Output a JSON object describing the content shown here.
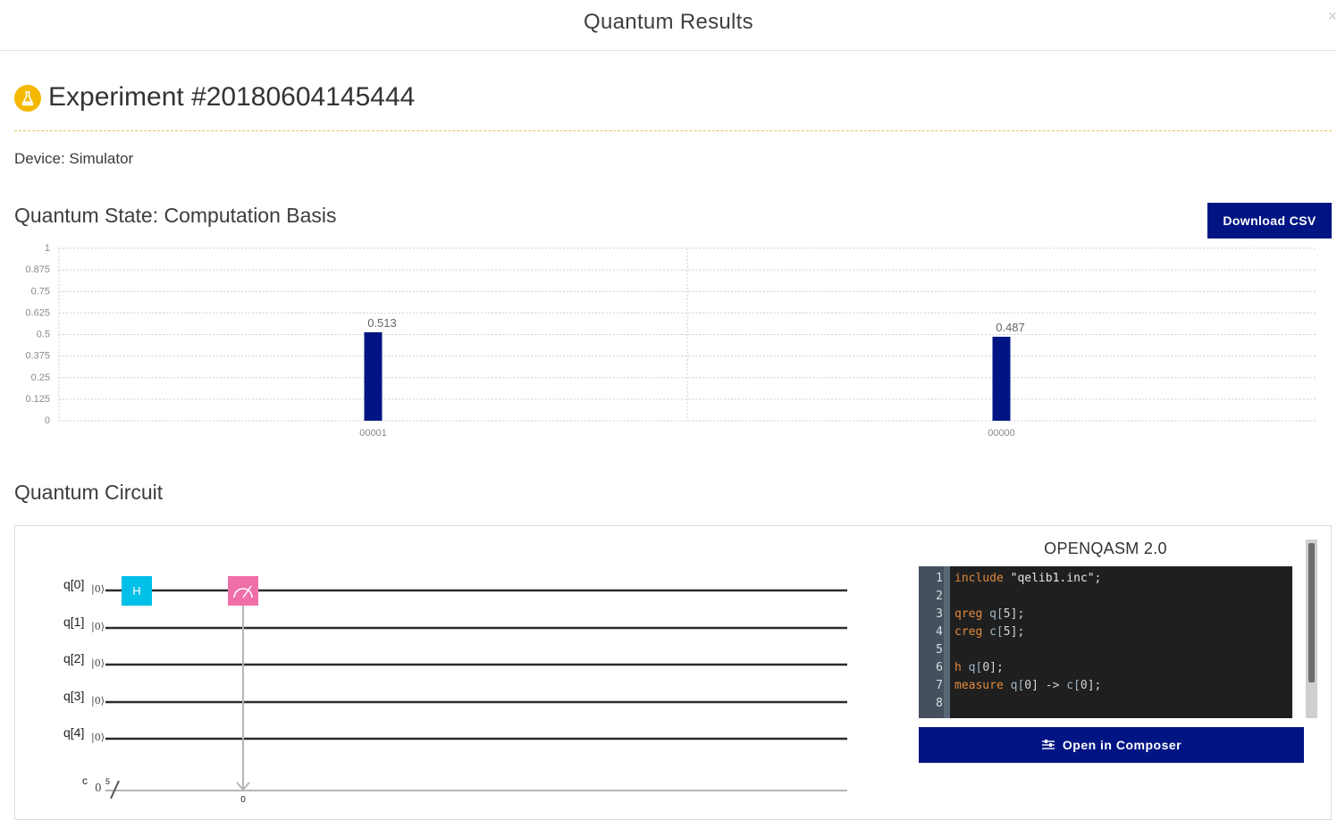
{
  "modal": {
    "title": "Quantum Results",
    "close": "×"
  },
  "experiment": {
    "title": "Experiment #20180604145444",
    "icon": "flask-icon"
  },
  "device": "Device: Simulator",
  "state_section": {
    "title": "Quantum State: Computation Basis",
    "download_label": "Download CSV"
  },
  "chart_data": {
    "type": "bar",
    "categories": [
      "00001",
      "00000"
    ],
    "values": [
      0.513,
      0.487
    ],
    "data_labels": [
      "0.513",
      "0.487"
    ],
    "yticks": [
      "1",
      "0.875",
      "0.75",
      "0.625",
      "0.5",
      "0.375",
      "0.25",
      "0.125",
      "0"
    ],
    "ylim": [
      0,
      1
    ],
    "grid": true,
    "bar_color": "#001583"
  },
  "circuit_section": {
    "title": "Quantum Circuit",
    "qubits": [
      "q[0]",
      "q[1]",
      "q[2]",
      "q[3]",
      "q[4]"
    ],
    "ket": "|0⟩",
    "classical": {
      "label": "c",
      "init": "0",
      "width": "5",
      "measure_target": "0"
    },
    "gates": [
      {
        "name": "H",
        "qubit": "q[0]",
        "color": "#00bfe8"
      },
      {
        "name": "measure",
        "qubit": "q[0]",
        "color": "#ef6fa8"
      }
    ]
  },
  "qasm": {
    "title": "OPENQASM 2.0",
    "lines": [
      {
        "n": "1",
        "text": "include \"qelib1.inc\";"
      },
      {
        "n": "2",
        "text": ""
      },
      {
        "n": "3",
        "text": "qreg q[5];"
      },
      {
        "n": "4",
        "text": "creg c[5];"
      },
      {
        "n": "5",
        "text": ""
      },
      {
        "n": "6",
        "text": "h q[0];"
      },
      {
        "n": "7",
        "text": "measure q[0] -> c[0];"
      },
      {
        "n": "8",
        "text": ""
      }
    ],
    "open_label": "Open in Composer"
  }
}
